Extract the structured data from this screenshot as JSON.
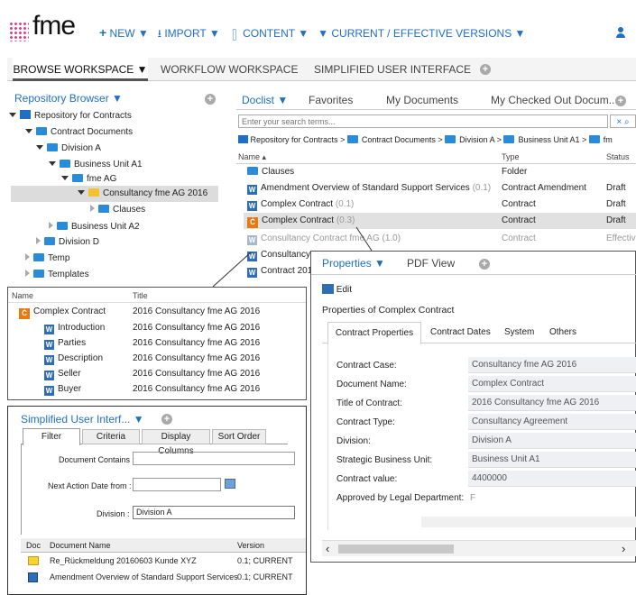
{
  "topbar": {
    "logo": "fme",
    "menu": [
      "NEW ▼",
      "IMPORT ▼",
      "CONTENT ▼",
      "CURRENT / EFFECTIVE VERSIONS ▼"
    ]
  },
  "workspace_tabs": [
    "BROWSE WORKSPACE ▼",
    "WORKFLOW WORKSPACE",
    "SIMPLIFIED USER INTERFACE"
  ],
  "repo": {
    "title": "Repository Browser ▼",
    "tree": [
      "Repository for Contracts",
      "Contract Documents",
      "Division A",
      "Business Unit A1",
      "fme AG",
      "Consultancy fme AG 2016",
      "Clauses",
      "Business Unit A2",
      "Division D",
      "Temp",
      "Templates"
    ]
  },
  "doclist": {
    "tabs": [
      "Doclist ▼",
      "Favorites",
      "My Documents",
      "My Checked Out Docum..."
    ],
    "search_placeholder": "Enter your search terms...",
    "clear": "× ⌕",
    "breadcrumb": [
      "Repository for Contracts",
      "Contract Documents",
      "Division A",
      "Business Unit A1",
      "fm"
    ],
    "headers": [
      "Name ▴",
      "Type",
      "Status"
    ],
    "rows": [
      {
        "name": "Clauses",
        "ver": "",
        "type": "Folder",
        "status": ""
      },
      {
        "name": "Amendment Overview of Standard Support Services",
        "ver": "(0.1)",
        "type": "Contract Amendment",
        "status": "Draft"
      },
      {
        "name": "Complex Contract",
        "ver": "(0.1)",
        "type": "Contract",
        "status": "Draft"
      },
      {
        "name": "Complex Contract",
        "ver": "(0.3)",
        "type": "Contract",
        "status": "Draft"
      },
      {
        "name": "Consultancy Contract fme AG",
        "ver": "(1.0)",
        "type": "Contract",
        "status": "Effectiv"
      },
      {
        "name": "Consultancy",
        "ver": "",
        "type": "",
        "status": ""
      },
      {
        "name": "Contract 201",
        "ver": "",
        "type": "",
        "status": ""
      }
    ]
  },
  "zoom": {
    "headers": [
      "Name",
      "Title"
    ],
    "rows": [
      {
        "name": "Complex Contract",
        "title": "2016 Consultancy fme AG 2016"
      },
      {
        "name": "Introduction",
        "title": "2016 Consultancy fme AG 2016"
      },
      {
        "name": "Parties",
        "title": "2016 Consultancy fme AG 2016"
      },
      {
        "name": "Description",
        "title": "2016 Consultancy fme AG 2016"
      },
      {
        "name": "Seller",
        "title": "2016 Consultancy fme AG 2016"
      },
      {
        "name": "Buyer",
        "title": "2016 Consultancy fme AG 2016"
      }
    ]
  },
  "simple": {
    "title": "Simplified User Interf... ▼",
    "tabs": [
      "Filter",
      "Criteria",
      "Display Columns",
      "Sort Order"
    ],
    "doc_contains": "Document Contains :",
    "next_action": "Next Action Date from :",
    "division_lbl": "Division :",
    "division_val": "Division A",
    "headers": [
      "Doc",
      "Document Name",
      "Version"
    ],
    "rows": [
      {
        "name": "Re_Rückmeldung 20160603 Kunde XYZ",
        "ver": "0.1; CURRENT"
      },
      {
        "name": "Amendment Overview of Standard Support Services",
        "ver": "0.1; CURRENT"
      }
    ]
  },
  "props": {
    "tabs": [
      "Properties ▼",
      "PDF View"
    ],
    "edit": "Edit",
    "heading": "Properties of Complex Contract",
    "subtabs": [
      "Contract Properties",
      "Contract Dates",
      "System",
      "Others"
    ],
    "fields": [
      {
        "label": "Contract Case:",
        "value": "Consultancy fme AG 2016"
      },
      {
        "label": "Document Name:",
        "value": "Complex Contract"
      },
      {
        "label": "Title of Contract:",
        "value": "2016 Consultancy fme AG 2016"
      },
      {
        "label": "Contract Type:",
        "value": "Consultancy Agreement"
      },
      {
        "label": "Division:",
        "value": "Division A"
      },
      {
        "label": "Strategic Business Unit:",
        "value": "Business Unit A1"
      },
      {
        "label": "Contract value:",
        "value": "4400000"
      },
      {
        "label": "Approved by Legal Department:",
        "value": "F"
      }
    ]
  }
}
